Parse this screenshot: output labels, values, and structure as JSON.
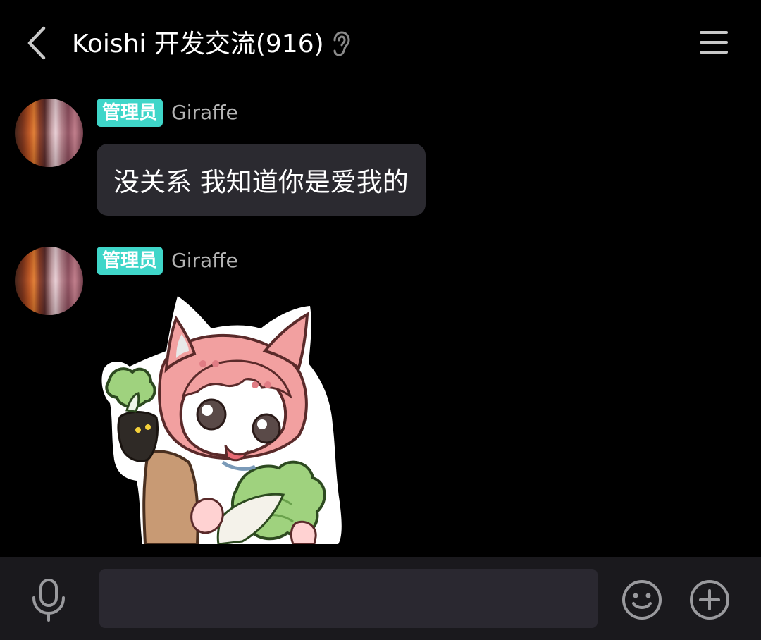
{
  "header": {
    "title": "Koishi 开发交流(916)",
    "back_icon": "chevron-left-icon",
    "ear_icon": "ear-icon",
    "menu_icon": "hamburger-menu-icon"
  },
  "messages": [
    {
      "role_badge": "管理员",
      "username": "Giraffe",
      "type": "text",
      "text": "没关系 我知道你是爱我的"
    },
    {
      "role_badge": "管理员",
      "username": "Giraffe",
      "type": "sticker",
      "sticker": "pink-cat-girl-holding-cabbage-sticker"
    }
  ],
  "input_bar": {
    "mic_icon": "microphone-icon",
    "placeholder": "",
    "emoji_icon": "emoji-smile-icon",
    "plus_icon": "plus-circle-icon"
  },
  "colors": {
    "background": "#000000",
    "badge": "#3fd6c9",
    "bubble": "#2b2a30",
    "input_bar": "#1a191d",
    "input_field": "#2a2830",
    "username": "#b4b4b4"
  }
}
